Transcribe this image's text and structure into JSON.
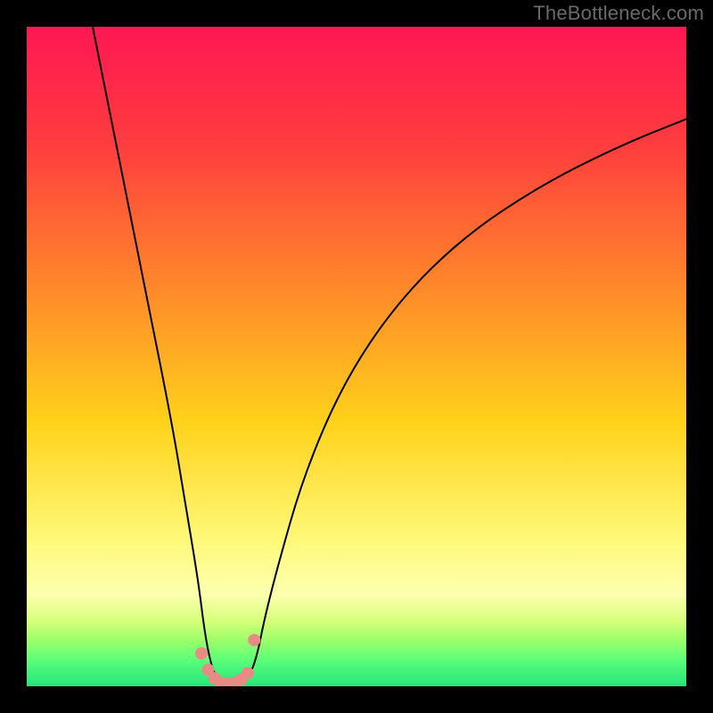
{
  "watermark": "TheBottleneck.com",
  "chart_data": {
    "type": "line",
    "title": "",
    "xlabel": "",
    "ylabel": "",
    "xlim": [
      0,
      100
    ],
    "ylim": [
      0,
      100
    ],
    "description": "Bottleneck-style V-shaped curve over a vertical red→yellow→green gradient. Y value corresponds to bottleneck severity (high = red/top, low = green/bottom). The curve dips to ~0 around x≈28–34 and rises steeply on both sides.",
    "series": [
      {
        "name": "bottleneck-curve",
        "x": [
          10,
          14,
          18,
          22,
          24,
          26,
          27,
          28,
          29,
          30,
          31,
          32,
          33,
          34,
          35,
          36,
          38,
          42,
          48,
          56,
          66,
          78,
          90,
          100
        ],
        "values": [
          100,
          80,
          60,
          40,
          28,
          16,
          8,
          3,
          1,
          0,
          0,
          0,
          1,
          2,
          5,
          10,
          18,
          32,
          46,
          58,
          68,
          76,
          82,
          86
        ]
      }
    ],
    "markers": {
      "name": "highlight-dots",
      "color": "#e98b84",
      "x": [
        26.5,
        27.5,
        28.5,
        29.5,
        30.5,
        31.5,
        32.5,
        33.5,
        34.5
      ],
      "values": [
        5.0,
        2.5,
        1.2,
        0.5,
        0.3,
        0.5,
        1.0,
        2.0,
        7.0
      ]
    },
    "gradient_stops": [
      {
        "pct": 0,
        "color": "#ff1753"
      },
      {
        "pct": 18,
        "color": "#ff3d3e"
      },
      {
        "pct": 40,
        "color": "#ff8a2a"
      },
      {
        "pct": 60,
        "color": "#ffd21a"
      },
      {
        "pct": 78,
        "color": "#fff97a"
      },
      {
        "pct": 86,
        "color": "#fdffb0"
      },
      {
        "pct": 90,
        "color": "#d7ff7a"
      },
      {
        "pct": 93,
        "color": "#9dff6a"
      },
      {
        "pct": 96,
        "color": "#5cff7a"
      },
      {
        "pct": 100,
        "color": "#23e57a"
      }
    ]
  }
}
